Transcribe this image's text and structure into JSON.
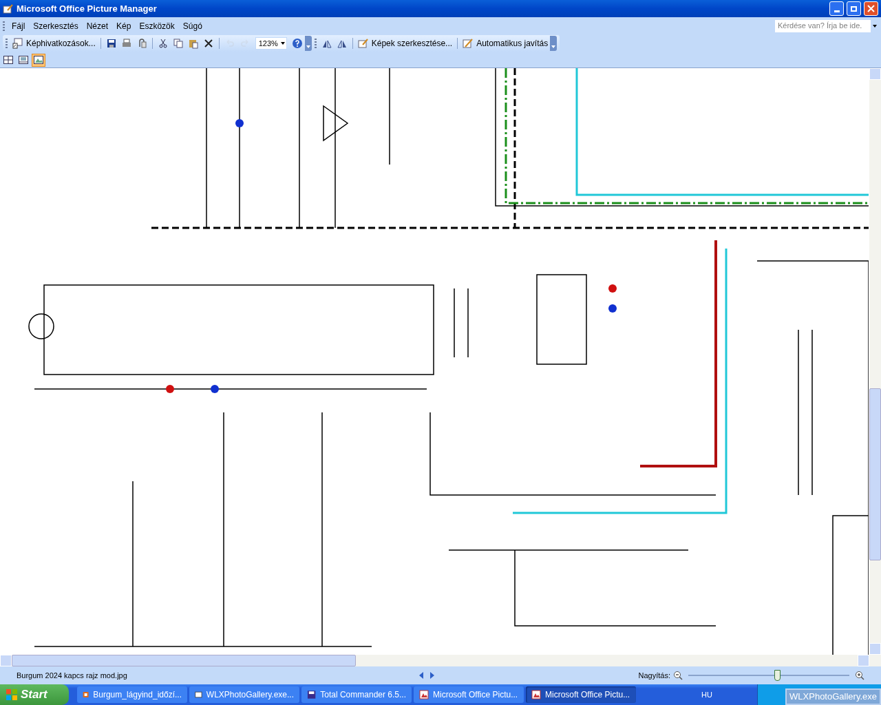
{
  "window": {
    "title": "Microsoft Office Picture Manager"
  },
  "menu": [
    {
      "label": "Fájl"
    },
    {
      "label": "Szerkesztés"
    },
    {
      "label": "Nézet"
    },
    {
      "label": "Kép"
    },
    {
      "label": "Eszközök"
    },
    {
      "label": "Súgó"
    }
  ],
  "help_search": {
    "placeholder": "Kérdése van? Írja be ide."
  },
  "toolbar": [
    {
      "kind": "button",
      "label": "Képhivatkozások...",
      "disabled": false
    },
    {
      "kind": "sep"
    },
    {
      "kind": "button",
      "disabled": false
    },
    {
      "kind": "button",
      "disabled": false
    },
    {
      "kind": "button",
      "disabled": false
    },
    {
      "kind": "sep"
    },
    {
      "kind": "button",
      "disabled": false
    },
    {
      "kind": "button",
      "disabled": false
    },
    {
      "kind": "button",
      "disabled": false
    },
    {
      "kind": "button",
      "disabled": false
    },
    {
      "kind": "sep"
    },
    {
      "kind": "button",
      "disabled": true
    },
    {
      "kind": "button",
      "disabled": true
    },
    {
      "kind": "combo",
      "value": "123%"
    },
    {
      "kind": "button",
      "disabled": false
    },
    {
      "kind": "end"
    },
    {
      "kind": "button",
      "disabled": false
    },
    {
      "kind": "button",
      "disabled": false
    },
    {
      "kind": "sep"
    },
    {
      "kind": "button",
      "label": "Képek szerkesztése...",
      "disabled": false
    },
    {
      "kind": "sep"
    },
    {
      "kind": "button",
      "label": "Automatikus javítás",
      "disabled": false
    },
    {
      "kind": "end"
    }
  ],
  "view_buttons": [
    {
      "selected": false
    },
    {
      "selected": false
    },
    {
      "selected": true
    }
  ],
  "status_bar": {
    "filename": "Burgum 2024 kapcs rajz mod.jpg",
    "zoom_label": "Nagyítás:",
    "zoom": {
      "level": 0.55
    }
  },
  "taskbar": {
    "start": "Start",
    "items": [
      {
        "label": "Burgum_lágyind_időzí...",
        "selected": false
      },
      {
        "label": "WLXPhotoGallery.exe...",
        "selected": false
      },
      {
        "label": "Total Commander 6.5...",
        "selected": false
      },
      {
        "label": "Microsoft Office Pictu...",
        "selected": false
      },
      {
        "label": "Microsoft Office Pictu...",
        "selected": true
      }
    ],
    "language": "HU",
    "tooltip": "WLXPhotoGallery.exe"
  }
}
